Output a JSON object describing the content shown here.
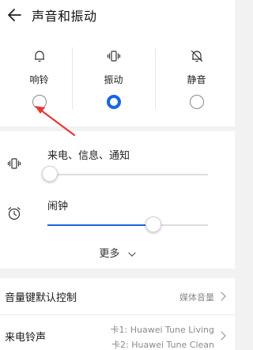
{
  "header": {
    "title": "声音和振动",
    "back_icon": "arrow-left-icon"
  },
  "modes": [
    {
      "label": "响铃",
      "icon": "bell-icon",
      "selected": false
    },
    {
      "label": "振动",
      "icon": "vibrate-icon",
      "selected": true
    },
    {
      "label": "静音",
      "icon": "bell-off-icon",
      "selected": false
    }
  ],
  "sliders": [
    {
      "label": "来电、信息、通知",
      "icon": "vibrate-icon",
      "level": 0.0
    },
    {
      "label": "闹钟",
      "icon": "alarm-clock-icon",
      "level": 0.66
    }
  ],
  "more_label": "更多",
  "settings": {
    "volume_key": {
      "title": "音量键默认控制",
      "value": "媒体音量"
    },
    "ringtone": {
      "title": "来电铃声",
      "sim1": "卡1: Huawei Tune Living",
      "sim2": "卡2: Huawei Tune Clean"
    }
  },
  "colors": {
    "accent": "#1a66e0",
    "annotation_arrow": "#e53935",
    "background": "#f2f2f2"
  }
}
